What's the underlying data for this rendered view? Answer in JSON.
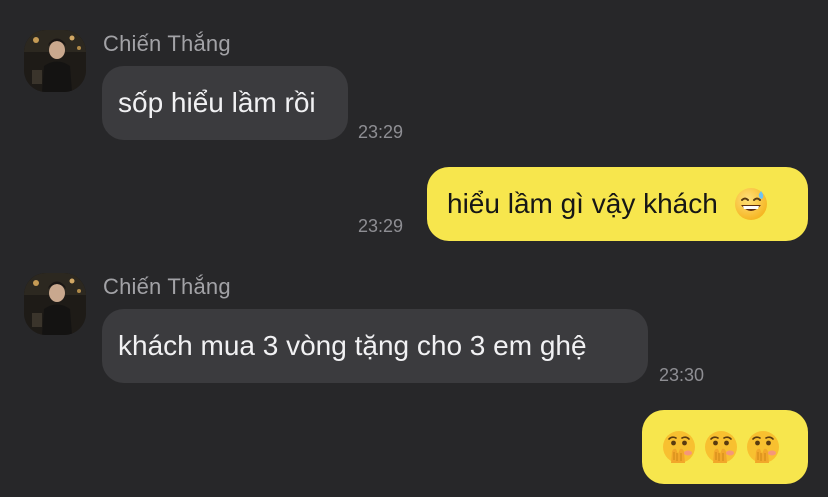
{
  "messages": [
    {
      "sender": "Chiến Thắng",
      "text": "sốp hiểu lầm rồi",
      "time": "23:29",
      "direction": "incoming"
    },
    {
      "text": "hiểu lầm gì vậy khách",
      "emoji": "grinning-sweat-emoji",
      "time": "23:29",
      "direction": "outgoing"
    },
    {
      "sender": "Chiến Thắng",
      "text": "khách mua 3 vòng tặng cho 3 em ghệ",
      "time": "23:30",
      "direction": "incoming"
    },
    {
      "emojis": [
        "hand-over-mouth-emoji",
        "hand-over-mouth-emoji",
        "hand-over-mouth-emoji"
      ],
      "direction": "outgoing"
    }
  ],
  "colors": {
    "background": "#272729",
    "incoming_bubble": "#3b3b3e",
    "outgoing_bubble": "#f7e64d",
    "sender_text": "#a2a2a6",
    "timestamp_text": "#8e8e93"
  }
}
